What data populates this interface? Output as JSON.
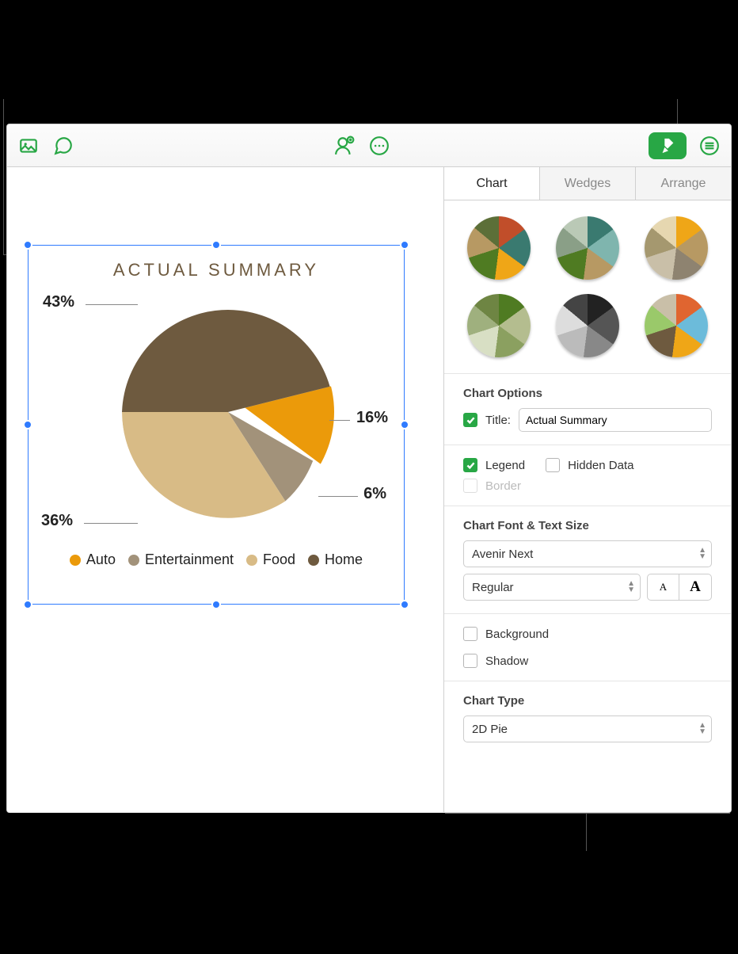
{
  "chart_data": {
    "type": "pie",
    "title": "ACTUAL SUMMARY",
    "series": [
      {
        "name": "Auto",
        "value": 16,
        "color": "#EB9A0A"
      },
      {
        "name": "Entertainment",
        "value": 6,
        "color": "#A2927A"
      },
      {
        "name": "Food",
        "value": 36,
        "color": "#D8BB86"
      },
      {
        "name": "Home",
        "value": 43,
        "color": "#6E5A3F"
      }
    ],
    "labels": [
      "16%",
      "6%",
      "36%",
      "43%"
    ]
  },
  "inspector": {
    "tabs": {
      "chart": "Chart",
      "wedges": "Wedges",
      "arrange": "Arrange"
    },
    "chart_options": {
      "heading": "Chart Options",
      "title_label": "Title:",
      "title_value": "Actual Summary",
      "legend_label": "Legend",
      "hidden_data_label": "Hidden Data",
      "border_label": "Border"
    },
    "font": {
      "heading": "Chart Font & Text Size",
      "family": "Avenir Next",
      "style": "Regular"
    },
    "background_label": "Background",
    "shadow_label": "Shadow",
    "chart_type": {
      "heading": "Chart Type",
      "value": "2D Pie"
    }
  },
  "style_thumbs": [
    [
      "#C14E2A",
      "#3A7A70",
      "#EFA617",
      "#4F7B22",
      "#B79963",
      "#5C6F38"
    ],
    [
      "#3A7A70",
      "#7FB5AE",
      "#B79963",
      "#4F7B22",
      "#8A9F87",
      "#BAC9B6"
    ],
    [
      "#EFA617",
      "#B79963",
      "#8E8370",
      "#C9BFA8",
      "#A5986F",
      "#E6D7B0"
    ],
    [
      "#4F7B22",
      "#B4BD8F",
      "#8BA060",
      "#D8DFC4",
      "#9FB07E",
      "#6E8543"
    ],
    [
      "#222",
      "#555",
      "#888",
      "#BBB",
      "#DDD",
      "#444"
    ],
    [
      "#E06530",
      "#6CBBDA",
      "#EFA617",
      "#6E5A3F",
      "#9AC96A",
      "#C9BFA8"
    ]
  ]
}
